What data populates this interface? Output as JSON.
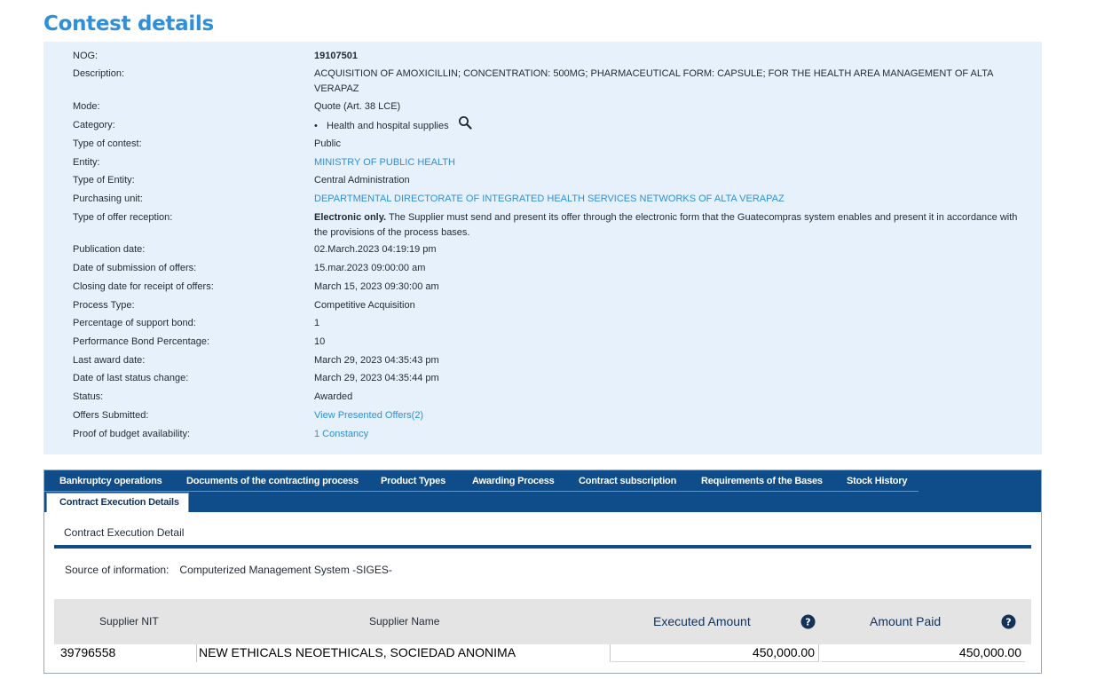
{
  "title": "Contest details",
  "details": [
    {
      "label": "NOG:",
      "value": "19107501",
      "bold": true
    },
    {
      "label": "Description:",
      "value": "ACQUISITION OF AMOXICILLIN; CONCENTRATION: 500MG; PHARMACEUTICAL FORM: CAPSULE; FOR THE HEALTH AREA MANAGEMENT OF ALTA VERAPAZ"
    },
    {
      "label": "Mode:",
      "value": "Quote (Art. 38 LCE)"
    },
    {
      "label": "Category:",
      "value": "Health and hospital supplies"
    },
    {
      "label": "Type of contest:",
      "value": "Public"
    },
    {
      "label": "Entity:",
      "value": "MINISTRY OF PUBLIC HEALTH"
    },
    {
      "label": "Type of Entity:",
      "value": "Central Administration"
    },
    {
      "label": "Purchasing unit:",
      "value": "DEPARTMENTAL DIRECTORATE OF INTEGRATED HEALTH SERVICES NETWORKS OF ALTA VERAPAZ"
    },
    {
      "label": "Type of offer reception:",
      "value_bold": "Electronic only.",
      "value": " The Supplier must send and present its offer through the electronic form that the Guatecompras system enables and present it in accordance with the provisions of the process bases."
    },
    {
      "label": "Publication date:",
      "value": "02.March.2023 04:19:19 pm"
    },
    {
      "label": "Date of submission of offers:",
      "value": "15.mar.2023 09:00:00 am"
    },
    {
      "label": "Closing date for receipt of offers:",
      "value": "March 15, 2023 09:30:00 am"
    },
    {
      "label": "Process Type:",
      "value": "Competitive Acquisition"
    },
    {
      "label": "Percentage of support bond:",
      "value": "1"
    },
    {
      "label": "Performance Bond Percentage:",
      "value": "10"
    },
    {
      "label": "Last award date:",
      "value": "March 29, 2023 04:35:43 pm"
    },
    {
      "label": "Date of last status change:",
      "value": "March 29, 2023 04:35:44 pm"
    },
    {
      "label": "Status:",
      "value": "Awarded"
    },
    {
      "label": "Offers Submitted:",
      "value": "View Presented Offers(2)"
    },
    {
      "label": "Proof of budget availability:",
      "value": "1 Constancy"
    }
  ],
  "category_bullet": "•",
  "tabs": [
    "Bankruptcy operations",
    "Documents of the contracting process",
    "Product Types",
    "Awarding Process",
    "Contract subscription",
    "Requirements of the Bases",
    "Stock History"
  ],
  "active_tab": "Contract Execution Details",
  "section_title": "Contract Execution Detail",
  "source_label": "Source of information:",
  "source_value": "Computerized Management System -SIGES-",
  "table": {
    "headers": [
      "Supplier NIT",
      "Supplier Name",
      "Executed Amount",
      "Amount Paid"
    ],
    "rows": [
      [
        "39796558",
        "NEW ETHICALS NEOETHICALS, SOCIEDAD ANONIMA",
        "450,000.00",
        "450,000.00"
      ]
    ]
  },
  "colors": {
    "accent": "#2f8fd8",
    "navy": "#0f4c8a",
    "panel": "#e6f1fb"
  }
}
